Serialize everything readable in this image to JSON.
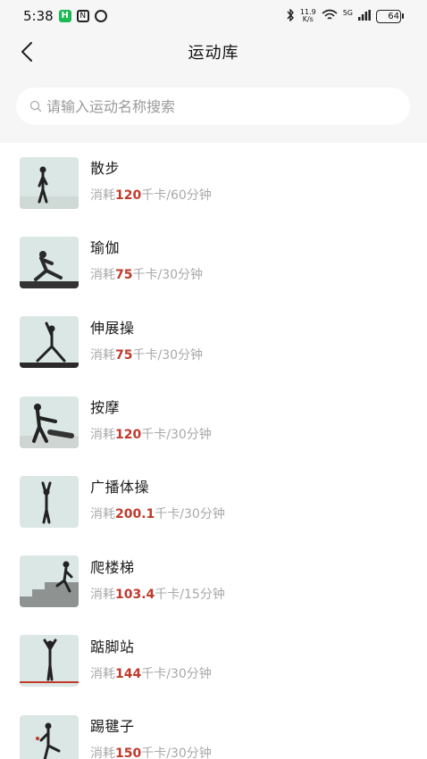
{
  "status_bar": {
    "time": "5:38",
    "badge_h": "H",
    "badge_n": "N",
    "net_speed_value": "11.9",
    "net_speed_unit": "K/s",
    "signal": "5G",
    "battery": "64"
  },
  "header": {
    "title": "运动库",
    "back_icon": "chevron-left-icon"
  },
  "search": {
    "placeholder": "请输入运动名称搜索",
    "value": ""
  },
  "colors": {
    "accent_red": "#c0392b",
    "muted_text": "#a8a8a8",
    "header_bg": "#f6f6f6"
  },
  "exercises": [
    {
      "name": "散步",
      "prefix": "消耗",
      "calories": "120",
      "suffix": "千卡/60分钟",
      "thumbnail": "walking-person-image"
    },
    {
      "name": "瑜伽",
      "prefix": "消耗",
      "calories": "75",
      "suffix": "千卡/30分钟",
      "thumbnail": "yoga-pose-image"
    },
    {
      "name": "伸展操",
      "prefix": "消耗",
      "calories": "75",
      "suffix": "千卡/30分钟",
      "thumbnail": "stretching-pose-image"
    },
    {
      "name": "按摩",
      "prefix": "消耗",
      "calories": "120",
      "suffix": "千卡/30分钟",
      "thumbnail": "massage-image"
    },
    {
      "name": "广播体操",
      "prefix": "消耗",
      "calories": "200.1",
      "suffix": "千卡/30分钟",
      "thumbnail": "calisthenics-image"
    },
    {
      "name": "爬楼梯",
      "prefix": "消耗",
      "calories": "103.4",
      "suffix": "千卡/15分钟",
      "thumbnail": "stair-climbing-image"
    },
    {
      "name": "踮脚站",
      "prefix": "消耗",
      "calories": "144",
      "suffix": "千卡/30分钟",
      "thumbnail": "tiptoe-standing-image"
    },
    {
      "name": "踢毽子",
      "prefix": "消耗",
      "calories": "150",
      "suffix": "千卡/30分钟",
      "thumbnail": "shuttlecock-kicking-image"
    }
  ]
}
